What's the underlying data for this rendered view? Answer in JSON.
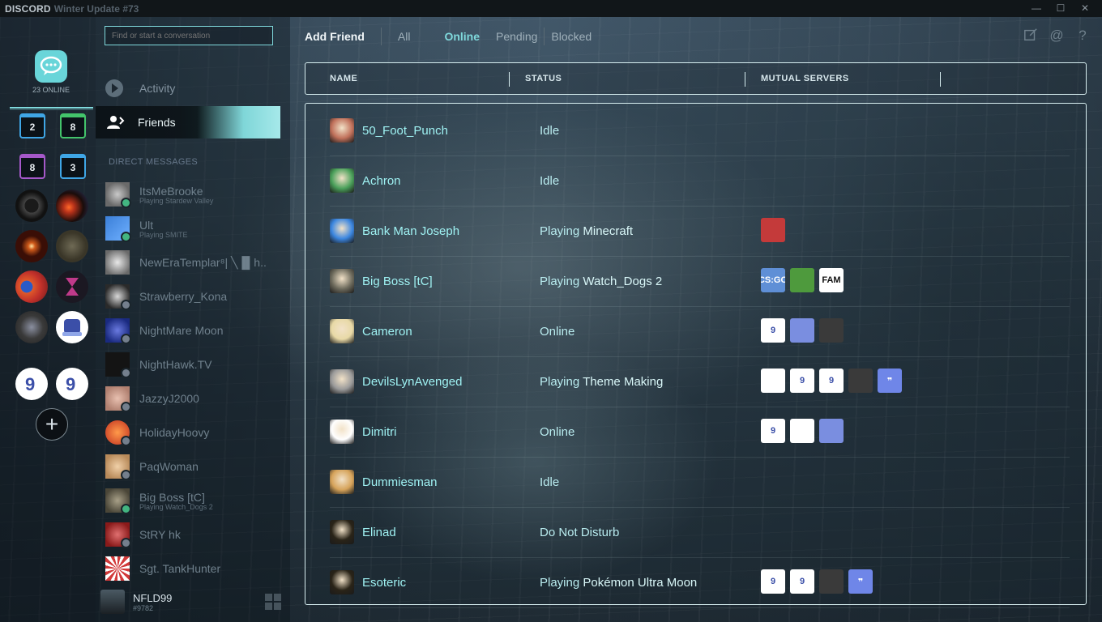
{
  "titlebar": {
    "brand": "DISCORD",
    "version": "Winter Update #73"
  },
  "window_controls": {
    "minimize": "—",
    "maximize": "☐",
    "close": "✕"
  },
  "servers": {
    "online_count": "23 ONLINE",
    "folders": [
      {
        "count": "2",
        "color": "#3fa6e6"
      },
      {
        "count": "8",
        "color": "#43c46b"
      },
      {
        "count": "8",
        "color": "#a558c9"
      },
      {
        "count": "3",
        "color": "#3fa6e6"
      }
    ],
    "add_label": "+"
  },
  "channels": {
    "search_placeholder": "Find or start a conversation",
    "activity_label": "Activity",
    "friends_label": "Friends",
    "dm_header": "DIRECT MESSAGES",
    "dms": [
      {
        "name": "ItsMeBrooke",
        "sub": "Playing Stardew Valley",
        "status": "#43b581",
        "color": "#8a8f93"
      },
      {
        "name": "Ult",
        "sub": "Playing SMITE",
        "status": "#43b581",
        "color": "#3b7fd8"
      },
      {
        "name": "NewEraTemplar⁸| ╲▐▌h..",
        "sub": "",
        "status": "",
        "color": "#dcdcdc"
      },
      {
        "name": "Strawberry_Kona",
        "sub": "",
        "status": "#747f8d",
        "color": "#c7c7c7"
      },
      {
        "name": "NightMare Moon",
        "sub": "",
        "status": "#747f8d",
        "color": "#2a3fa0"
      },
      {
        "name": "NightHawk.TV",
        "sub": "",
        "status": "#747f8d",
        "color": "#141414"
      },
      {
        "name": "JazzyJ2000",
        "sub": "",
        "status": "#747f8d",
        "color": "#c9a08c"
      },
      {
        "name": "HolidayHoovy",
        "sub": "",
        "status": "#747f8d",
        "color": "#e07a3a"
      },
      {
        "name": "PaqWoman",
        "sub": "",
        "status": "#747f8d",
        "color": "#d4b48c"
      },
      {
        "name": "Big Boss [tC]",
        "sub": "Playing Watch_Dogs 2",
        "status": "#43b581",
        "color": "#6d6a5c"
      },
      {
        "name": "StRY hk",
        "sub": "",
        "status": "#747f8d",
        "color": "#b03030"
      },
      {
        "name": "Sgt. TankHunter",
        "sub": "",
        "status": "",
        "color": "#d23a3a"
      }
    ]
  },
  "user": {
    "name": "NFLD99",
    "tag": "#9782"
  },
  "topnav": {
    "add_friend": "Add Friend",
    "all": "All",
    "online": "Online",
    "pending": "Pending",
    "blocked": "Blocked",
    "icons": [
      "new-group-dm-icon",
      "mentions-icon",
      "help-icon"
    ]
  },
  "table": {
    "headers": {
      "name": "NAME",
      "status": "STATUS",
      "mutual": "MUTUAL SERVERS"
    },
    "rows": [
      {
        "name": "50_Foot_Punch",
        "status_prefix": "Idle",
        "status_game": "",
        "avatar": "#c0705a",
        "mutual": []
      },
      {
        "name": "Achron",
        "status_prefix": "Idle",
        "status_game": "",
        "avatar": "#4aa05a",
        "mutual": []
      },
      {
        "name": "Bank Man Joseph",
        "status_prefix": "Playing ",
        "status_game": "Minecraft",
        "avatar": "#3b86e0",
        "mutual": [
          {
            "bg": "#c43a3a",
            "fg": "#2d5cc9",
            "text": ""
          }
        ]
      },
      {
        "name": "Big Boss [tC]",
        "status_prefix": "Playing ",
        "status_game": "Watch_Dogs 2",
        "avatar": "#6d6a5c",
        "mutual": [
          {
            "bg": "#5f8fd6",
            "fg": "#ffffff",
            "text": "CS:GO"
          },
          {
            "bg": "#4e9a3d",
            "fg": "#ffffff",
            "text": ""
          },
          {
            "bg": "#ffffff",
            "fg": "#111111",
            "text": "FAM"
          }
        ]
      },
      {
        "name": "Cameron",
        "status_prefix": "Online",
        "status_game": "",
        "avatar": "#e8d9a6",
        "mutual": [
          {
            "bg": "#ffffff",
            "fg": "#3b4fa8",
            "text": "9"
          },
          {
            "bg": "#7a8ee0",
            "fg": "#ffffff",
            "text": ""
          },
          {
            "bg": "#3a3a3a",
            "fg": "#ffffff",
            "text": ""
          }
        ]
      },
      {
        "name": "DevilsLynAvenged",
        "status_prefix": "Playing ",
        "status_game": "Theme Making",
        "avatar": "#9a9a9a",
        "mutual": [
          {
            "bg": "#ffffff",
            "fg": "#3b4fa8",
            "text": ""
          },
          {
            "bg": "#ffffff",
            "fg": "#3b4fa8",
            "text": "9"
          },
          {
            "bg": "#ffffff",
            "fg": "#3b4fa8",
            "text": "9"
          },
          {
            "bg": "#3a3a3a",
            "fg": "#ffffff",
            "text": ""
          },
          {
            "bg": "#6f86e8",
            "fg": "#ffffff",
            "text": "❞"
          }
        ]
      },
      {
        "name": "Dimitri",
        "status_prefix": "Online",
        "status_game": "",
        "avatar": "#ffffff",
        "mutual": [
          {
            "bg": "#ffffff",
            "fg": "#3b4fa8",
            "text": "9"
          },
          {
            "bg": "#ffffff",
            "fg": "#333333",
            "text": ""
          },
          {
            "bg": "#7a8ee0",
            "fg": "#ffffff",
            "text": ""
          }
        ]
      },
      {
        "name": "Dummiesman",
        "status_prefix": "Idle",
        "status_game": "",
        "avatar": "#d6a35a",
        "mutual": []
      },
      {
        "name": "Elinad",
        "status_prefix": "Do Not Disturb",
        "status_game": "",
        "avatar": "#2a2418",
        "mutual": []
      },
      {
        "name": "Esoteric",
        "status_prefix": "Playing ",
        "status_game": "Pokémon Ultra Moon",
        "avatar": "#2a2418",
        "mutual": [
          {
            "bg": "#ffffff",
            "fg": "#3b4fa8",
            "text": "9"
          },
          {
            "bg": "#ffffff",
            "fg": "#3b4fa8",
            "text": "9"
          },
          {
            "bg": "#3a3a3a",
            "fg": "#ffffff",
            "text": ""
          },
          {
            "bg": "#6f86e8",
            "fg": "#ffffff",
            "text": "❞"
          }
        ]
      }
    ]
  },
  "accent": "#7fd9dc"
}
